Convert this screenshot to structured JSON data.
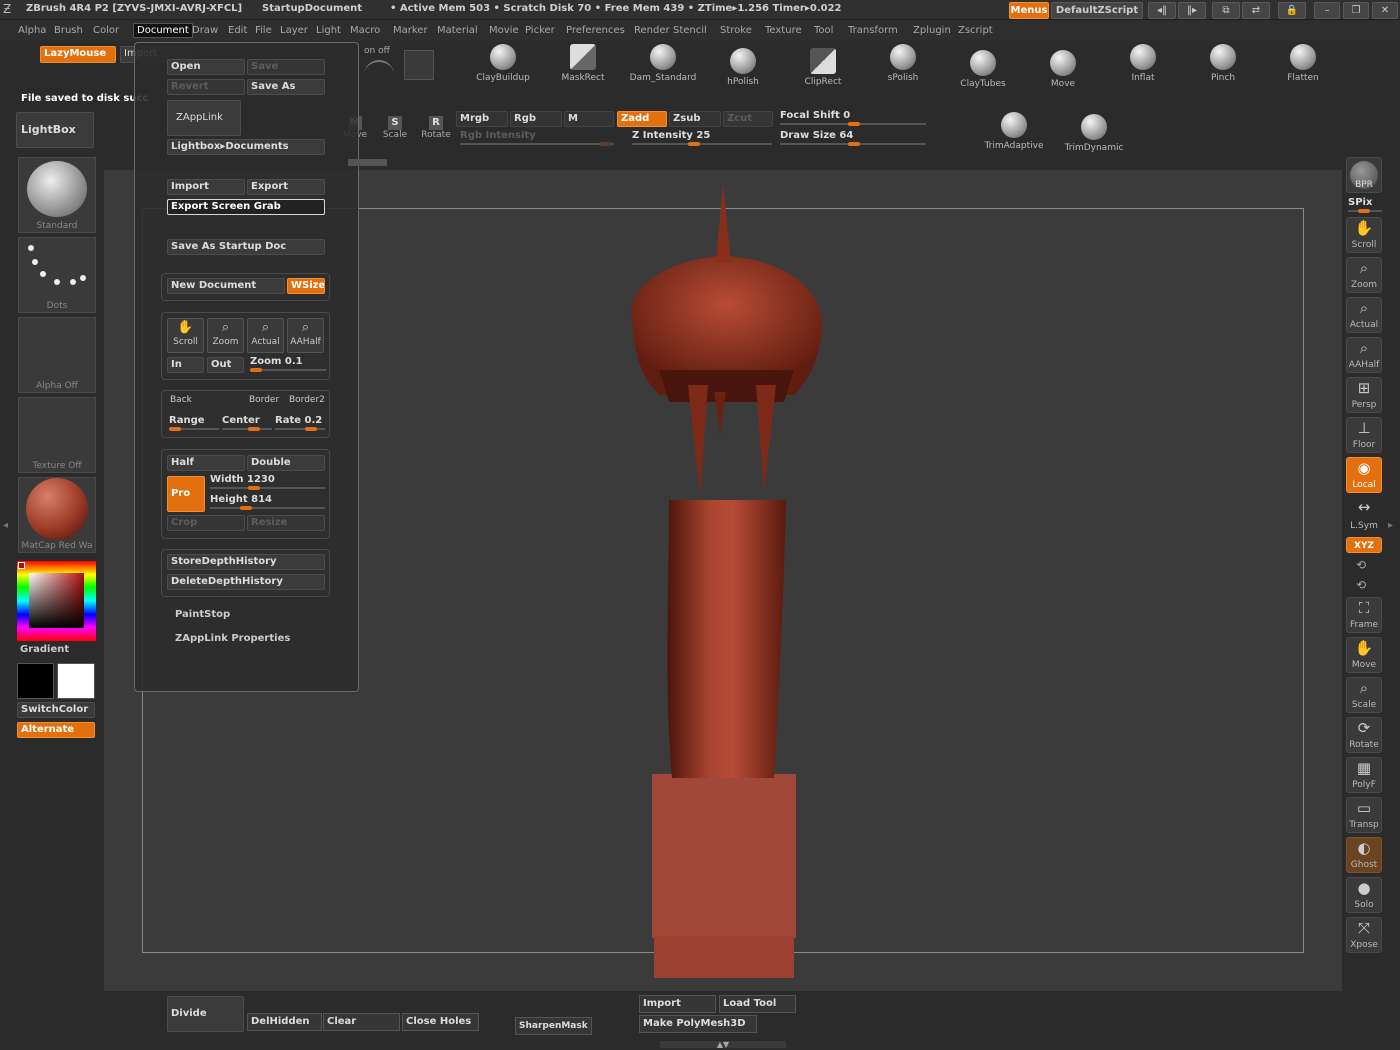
{
  "titlebar": {
    "app": "ZBrush 4R4 P2 [ZYVS-JMXI-AVRJ-XFCL]",
    "doc": "StartupDocument",
    "stats": "• Active Mem 503 • Scratch Disk 70 • Free Mem 439 • ZTime▸1.256 Timer▸0.022",
    "menus_btn": "Menus",
    "zscript_btn": "DefaultZScript"
  },
  "menubar": [
    "Alpha",
    "Brush",
    "Color",
    "Document",
    "Draw",
    "Edit",
    "File",
    "Layer",
    "Light",
    "Macro",
    "Marker",
    "Material",
    "Movie",
    "Picker",
    "Preferences",
    "Render",
    "Stencil",
    "Stroke",
    "Texture",
    "Tool",
    "Transform",
    "Zplugin",
    "Zscript"
  ],
  "menubar_active": "Document",
  "top": {
    "lazymouse": "LazyMouse",
    "import_partial": "Import",
    "onoff": "on off",
    "status": "File saved to disk succ",
    "lightbox": "LightBox",
    "move": "Move",
    "scale": "Scale",
    "rotate": "Rotate",
    "mrgb": "Mrgb",
    "rgb": "Rgb",
    "m": "M",
    "rgb_intensity": "Rgb Intensity",
    "zadd": "Zadd",
    "zsub": "Zsub",
    "zcut": "Zcut",
    "z_intensity": "Z Intensity",
    "z_intensity_val": "25",
    "focal_shift": "Focal Shift",
    "focal_shift_val": "0",
    "draw_size": "Draw Size",
    "draw_size_val": "64"
  },
  "brushes": [
    "ClayBuildup",
    "MaskRect",
    "Dam_Standard",
    "hPolish",
    "ClipRect",
    "sPolish",
    "ClayTubes",
    "Move",
    "Inflat",
    "Pinch",
    "Flatten",
    "TrimAdaptive",
    "TrimDynamic"
  ],
  "left": {
    "standard": "Standard",
    "dots": "Dots",
    "alpha_off": "Alpha Off",
    "texture_off": "Texture Off",
    "matcap": "MatCap Red Wa",
    "gradient": "Gradient",
    "switchcolor": "SwitchColor",
    "alternate": "Alternate"
  },
  "document_menu": {
    "open": "Open",
    "save": "Save",
    "revert": "Revert",
    "save_as": "Save As",
    "zapplink": "ZAppLink",
    "lightbox_docs": "Lightbox▸Documents",
    "import": "Import",
    "export": "Export",
    "export_screen_grab": "Export Screen Grab",
    "save_startup": "Save As Startup Doc",
    "new_document": "New Document",
    "wsize": "WSize",
    "scroll": "Scroll",
    "zoom": "Zoom",
    "actual": "Actual",
    "aahalf": "AAHalf",
    "in": "In",
    "out": "Out",
    "zoom_label": "Zoom",
    "zoom_val": "0.1",
    "back": "Back",
    "border": "Border",
    "border2": "Border2",
    "range": "Range",
    "center": "Center",
    "rate": "Rate",
    "rate_val": "0.2",
    "half": "Half",
    "double": "Double",
    "pro": "Pro",
    "width_label": "Width",
    "width_val": "1230",
    "height_label": "Height",
    "height_val": "814",
    "crop": "Crop",
    "resize": "Resize",
    "store_depth": "StoreDepthHistory",
    "delete_depth": "DeleteDepthHistory",
    "paintstop": "PaintStop",
    "zapplink_props": "ZAppLink Properties"
  },
  "right": {
    "bpr": "BPR",
    "spix": "SPix",
    "items": [
      "Scroll",
      "Zoom",
      "Actual",
      "AAHalf",
      "Persp",
      "Floor",
      "Local",
      "L.Sym",
      "XYZ",
      "Frame",
      "Move",
      "Scale",
      "Rotate",
      "PolyF",
      "Transp",
      "Ghost",
      "Solo",
      "Xpose"
    ]
  },
  "bottom": {
    "divide": "Divide",
    "delhidden": "DelHidden",
    "clear": "Clear",
    "close_holes": "Close Holes",
    "sharpenmask": "SharpenMask",
    "import": "Import",
    "load_tool": "Load Tool",
    "make_polymesh": "Make PolyMesh3D"
  },
  "colors": {
    "accent": "#e3700f",
    "model": "#9c3a26"
  }
}
